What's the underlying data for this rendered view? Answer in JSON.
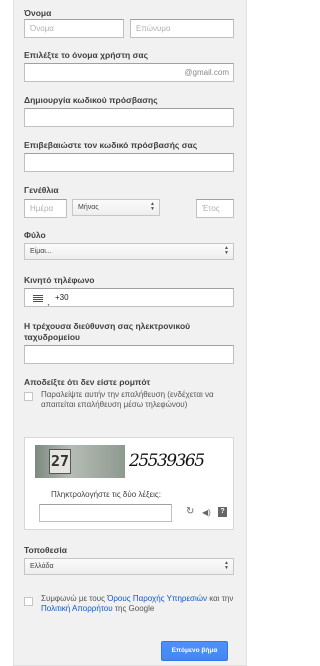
{
  "name": {
    "label": "Όνομα",
    "first_placeholder": "Όνομα",
    "last_placeholder": "Επώνυμο"
  },
  "username": {
    "label": "Επιλέξτε το όνομα χρήστη σας",
    "suffix": "@gmail.com"
  },
  "password": {
    "label": "Δημιουργία κωδικού πρόσβασης"
  },
  "confirm_password": {
    "label": "Επιβεβαιώστε τον κωδικό πρόσβασής σας"
  },
  "birthday": {
    "label": "Γενέθλια",
    "day_placeholder": "Ημέρα",
    "month_value": "Μήνας",
    "year_placeholder": "Έτος"
  },
  "gender": {
    "label": "Φύλο",
    "value": "Είμαι..."
  },
  "phone": {
    "label": "Κινητό τηλέφωνο",
    "code": "+30"
  },
  "email": {
    "label": "Η τρέχουσα διεύθυνση σας ηλεκτρονικού ταχυδρομείου"
  },
  "robot": {
    "label": "Αποδείξτε ότι δεν είστε ρομπότ",
    "skip_text": "Παραλείψτε αυτήν την επαλήθευση (ενδέχεται να απαιτείται επαλήθευση μέσω τηλεφώνου)",
    "captcha_left": "27",
    "captcha_right": "25539365",
    "prompt": "Πληκτρολογήστε τις δύο λέξεις:",
    "help": "?"
  },
  "location": {
    "label": "Τοποθεσία",
    "value": "Ελλάδα"
  },
  "terms": {
    "pre": "Συμφωνώ με τους ",
    "link1": "Όρους Παροχής Υπηρεσιών",
    "mid": " και την ",
    "link2": "Πολιτική Απορρήτου",
    "post": " της Google"
  },
  "submit": {
    "label": "Επόμενο βήμα"
  },
  "colors": {
    "accent": "#4d90fe",
    "link": "#1155cc",
    "panel": "#f1f1f1"
  }
}
